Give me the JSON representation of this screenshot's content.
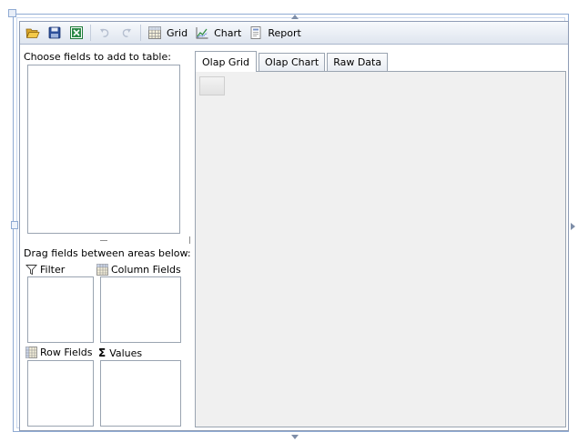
{
  "toolbar": {
    "open_icon": "folder-open-icon",
    "save_icon": "floppy-disk-icon",
    "excel_icon": "excel-export-icon",
    "undo_icon": "undo-icon",
    "redo_icon": "redo-icon",
    "grid_label": "Grid",
    "chart_label": "Chart",
    "report_label": "Report"
  },
  "left_panel": {
    "choose_fields_caption": "Choose fields to add to table:",
    "drag_fields_caption": "Drag fields between areas below:",
    "areas": {
      "filter_label": "Filter",
      "column_fields_label": "Column Fields",
      "row_fields_label": "Row Fields",
      "values_label": "Values",
      "values_symbol": "Σ"
    }
  },
  "tabs": [
    {
      "label": "Olap Grid",
      "active": true
    },
    {
      "label": "Olap Chart",
      "active": false
    },
    {
      "label": "Raw Data",
      "active": false
    }
  ],
  "colors": {
    "accent": "#8faad3",
    "border": "#9aa4b1",
    "content_bg": "#f0f0f0",
    "excel_green": "#1f7a3a"
  }
}
